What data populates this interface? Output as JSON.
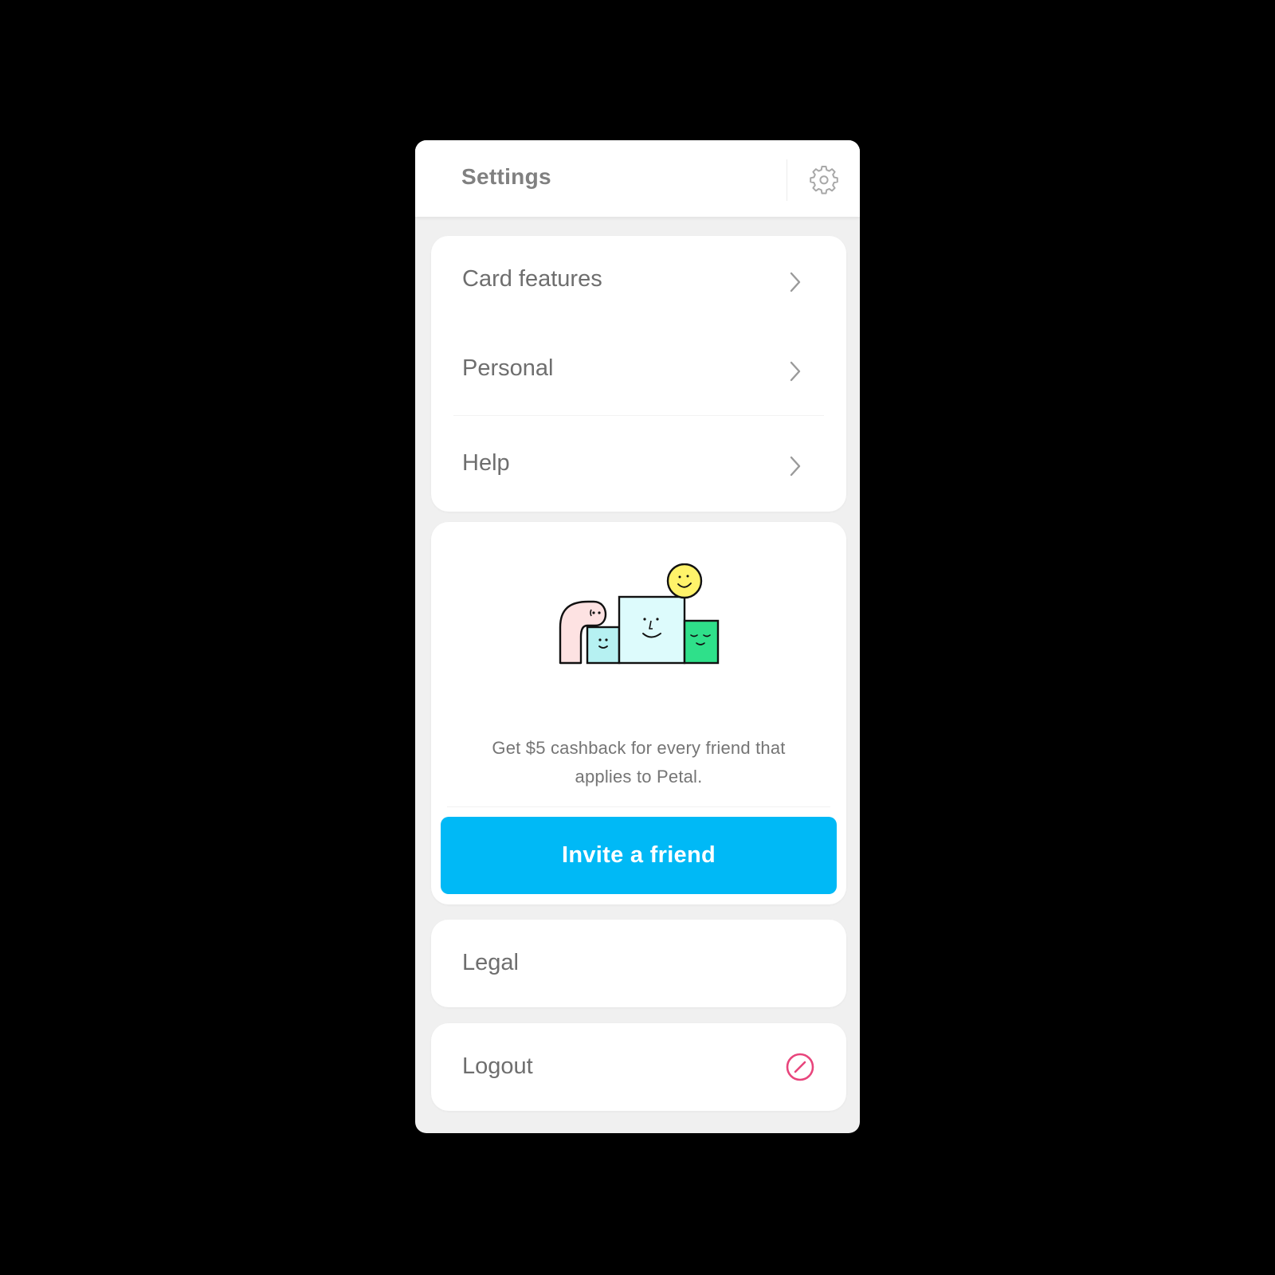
{
  "header": {
    "title": "Settings",
    "settings_icon": "gear-icon"
  },
  "menu": {
    "items": [
      {
        "label": "Card features",
        "icon": "chevron-right-icon"
      },
      {
        "label": "Personal",
        "icon": "chevron-right-icon"
      },
      {
        "label": "Help",
        "icon": "chevron-right-icon"
      }
    ]
  },
  "promo": {
    "illustration": "friends-illustration",
    "text": "Get $5 cashback for every friend that applies to Petal.",
    "button_label": "Invite a friend"
  },
  "legal": {
    "label": "Legal"
  },
  "logout": {
    "label": "Logout",
    "icon": "logout-icon"
  },
  "colors": {
    "accent": "#00b9f6",
    "logout_icon": "#e8457c",
    "background": "#f0f0f0",
    "text": "#6e6e6e"
  }
}
